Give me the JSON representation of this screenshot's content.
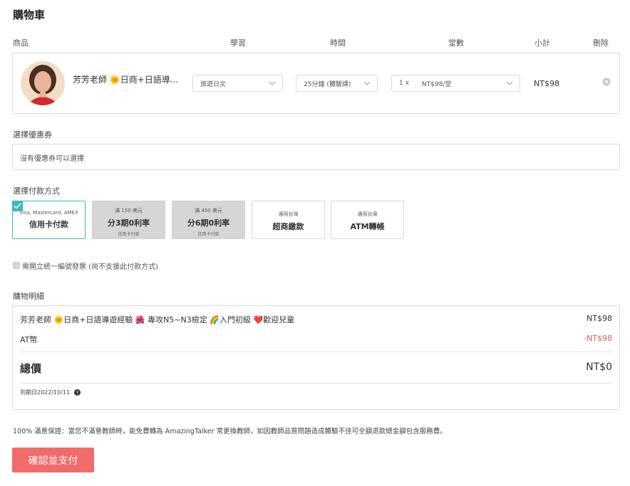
{
  "page": {
    "title": "購物車"
  },
  "columns": {
    "product": "商品",
    "study": "學習",
    "time": "時間",
    "lessons": "堂數",
    "subtotal": "小計",
    "delete": "刪除"
  },
  "cart_item": {
    "teacher": "芳芳老師 🌞日商+日語導...",
    "study_value": "旅遊日文",
    "time_value": "25分鐘 (體驗課)",
    "lessons_qty": "1 x",
    "lessons_price": "NT$98/堂",
    "subtotal": "NT$98"
  },
  "coupon": {
    "label": "選擇優惠券",
    "value": "沒有優惠券可以選擇"
  },
  "payment": {
    "label": "選擇付款方式",
    "methods": [
      {
        "small": "Visa, Mastercard, AMEX",
        "big": "信用卡付款",
        "tiny": ""
      },
      {
        "small": "滿 150 美元",
        "big": "分3期0利率",
        "tiny": "信用卡付款"
      },
      {
        "small": "滿 450 美元",
        "big": "分6期0利率",
        "tiny": "信用卡付款"
      },
      {
        "small": "適用台灣",
        "big": "超商繳款",
        "tiny": ""
      },
      {
        "small": "適用台灣",
        "big": "ATM轉帳",
        "tiny": ""
      }
    ]
  },
  "invoice": {
    "label": "需開立統一編號發票 (尚不支援此付款方式)"
  },
  "details": {
    "label": "購物明細",
    "item_text": "芳芳老師 🌞日商+日語導遊經驗 🌺 專攻N5~N3檢定 🌈入門初級 ❤️歡迎兒童",
    "item_price": "NT$98",
    "discount_label": "AT幣",
    "discount_value": "-NT$98",
    "total_label": "總價",
    "total_value": "NT$0",
    "expiry": "到期日2022/10/11"
  },
  "guarantee": "100% 滿意保證：當您不滿意教師時，能免費轉為 AmazingTalker 常更換教師，如因教師品質問題造成體驗不佳可全額退款總金額包含服務費。",
  "confirm_label": "確認並支付",
  "colors": {
    "accent": "#3cb7c4",
    "confirm": "#f26b6b",
    "discount": "#e05a5a"
  }
}
